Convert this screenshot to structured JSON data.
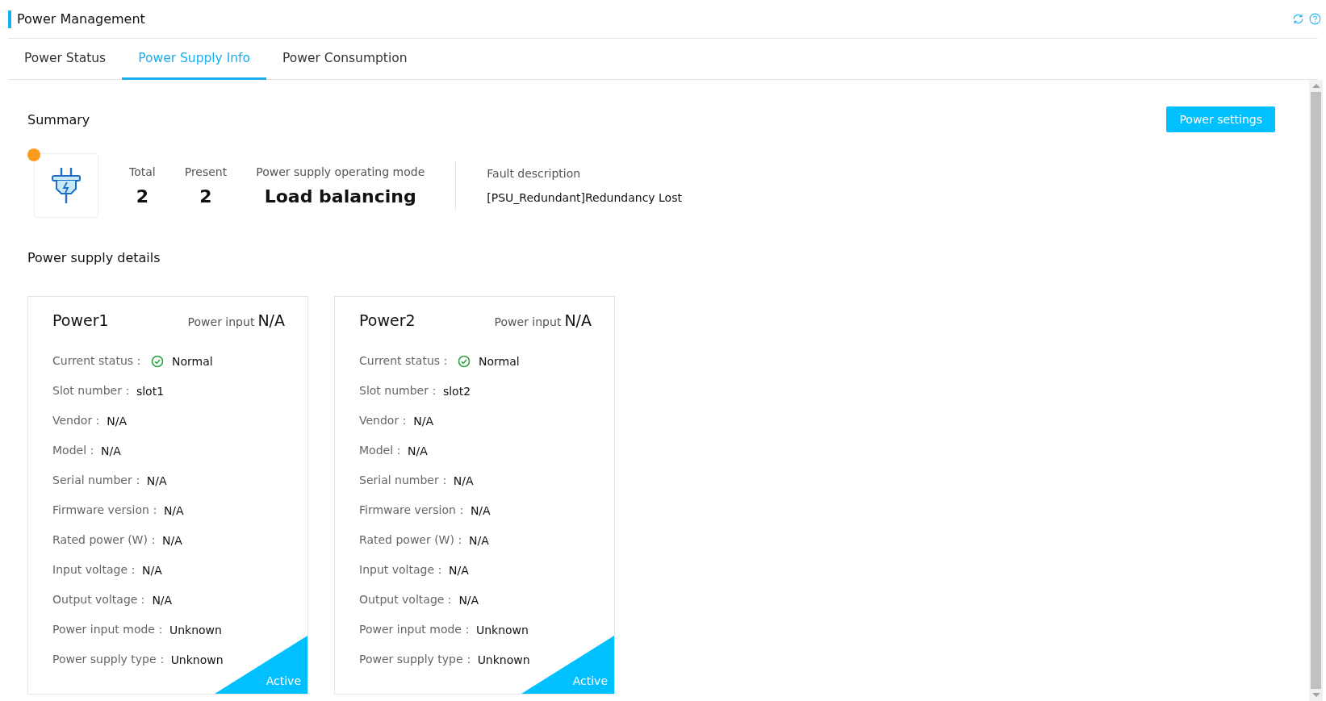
{
  "header": {
    "title": "Power Management"
  },
  "tabs": [
    {
      "label": "Power Status",
      "selected": false
    },
    {
      "label": "Power Supply Info",
      "selected": true
    },
    {
      "label": "Power Consumption",
      "selected": false
    }
  ],
  "summary": {
    "title": "Summary",
    "alert": true,
    "button": "Power settings",
    "stats": [
      {
        "label": "Total",
        "value": "2"
      },
      {
        "label": "Present",
        "value": "2"
      },
      {
        "label": "Power supply operating mode",
        "value": "Load balancing"
      }
    ],
    "fault": {
      "label": "Fault description",
      "value": "[PSU_Redundant]Redundancy Lost"
    }
  },
  "details": {
    "title": "Power supply details",
    "cards": [
      {
        "name": "Power1",
        "input_label": "Power input",
        "input_value": "N/A",
        "badge": "Active",
        "fields": [
          {
            "label": "Current status：",
            "value": "Normal",
            "ok": true
          },
          {
            "label": "Slot number：",
            "value": "slot1"
          },
          {
            "label": "Vendor：",
            "value": "N/A"
          },
          {
            "label": "Model：",
            "value": "N/A"
          },
          {
            "label": "Serial number：",
            "value": "N/A"
          },
          {
            "label": "Firmware version：",
            "value": "N/A"
          },
          {
            "label": "Rated power (W)：",
            "value": "N/A"
          },
          {
            "label": "Input voltage：",
            "value": "N/A"
          },
          {
            "label": "Output voltage：",
            "value": "N/A"
          },
          {
            "label": "Power input mode：",
            "value": "Unknown"
          },
          {
            "label": "Power supply type：",
            "value": "Unknown"
          }
        ]
      },
      {
        "name": "Power2",
        "input_label": "Power input",
        "input_value": "N/A",
        "badge": "Active",
        "fields": [
          {
            "label": "Current status：",
            "value": "Normal",
            "ok": true
          },
          {
            "label": "Slot number：",
            "value": "slot2"
          },
          {
            "label": "Vendor：",
            "value": "N/A"
          },
          {
            "label": "Model：",
            "value": "N/A"
          },
          {
            "label": "Serial number：",
            "value": "N/A"
          },
          {
            "label": "Firmware version：",
            "value": "N/A"
          },
          {
            "label": "Rated power (W)：",
            "value": "N/A"
          },
          {
            "label": "Input voltage：",
            "value": "N/A"
          },
          {
            "label": "Output voltage：",
            "value": "N/A"
          },
          {
            "label": "Power input mode：",
            "value": "Unknown"
          },
          {
            "label": "Power supply type：",
            "value": "Unknown"
          }
        ]
      }
    ]
  }
}
